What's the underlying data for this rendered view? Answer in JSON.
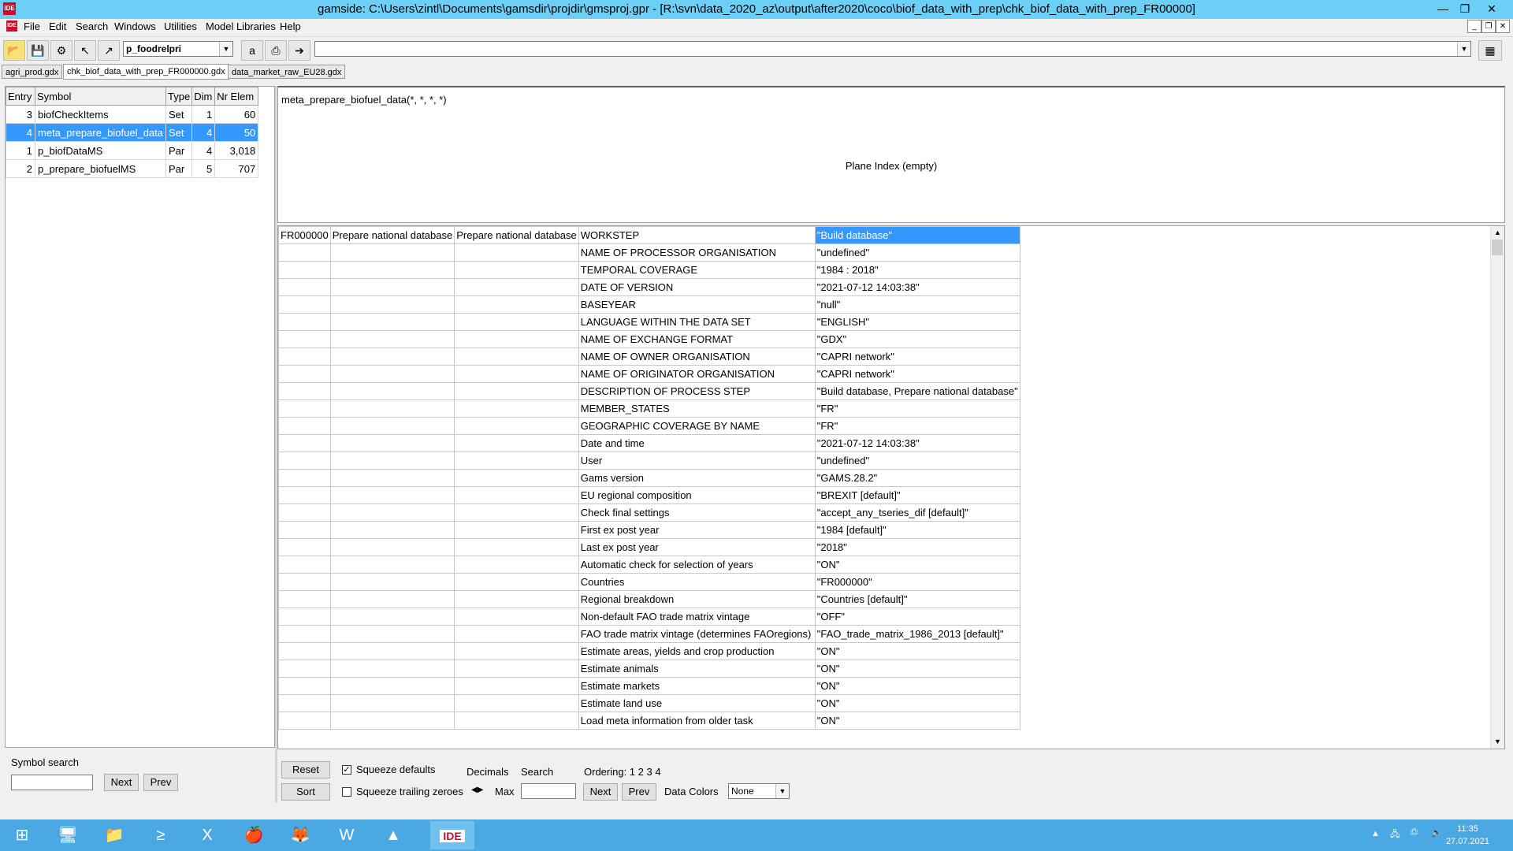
{
  "window": {
    "title": "gamside: C:\\Users\\zintl\\Documents\\gamsdir\\projdir\\gmsproj.gpr - [R:\\svn\\data_2020_az\\output\\after2020\\coco\\biof_data_with_prep\\chk_biof_data_with_prep_FR00000]",
    "app_icon_text": "IDE"
  },
  "menu": [
    "File",
    "Edit",
    "Search",
    "Windows",
    "Utilities",
    "Model Libraries",
    "Help"
  ],
  "toolbar": {
    "symbol_combo_value": "p_foodrelpri",
    "a_label": "a",
    "command_combo_value": ""
  },
  "tabs": [
    "agri_prod.gdx",
    "chk_biof_data_with_prep_FR000000.gdx",
    "data_market_raw_EU28.gdx"
  ],
  "symbols": {
    "headers": [
      "Entry",
      "Symbol",
      "Type",
      "Dim",
      "Nr Elem"
    ],
    "rows": [
      {
        "entry": "3",
        "symbol": "biofCheckItems",
        "type": "Set",
        "dim": "1",
        "nr": "60"
      },
      {
        "entry": "4",
        "symbol": "meta_prepare_biofuel_data",
        "type": "Set",
        "dim": "4",
        "nr": "50"
      },
      {
        "entry": "1",
        "symbol": "p_biofDataMS",
        "type": "Par",
        "dim": "4",
        "nr": "3,018"
      },
      {
        "entry": "2",
        "symbol": "p_prepare_biofuelMS",
        "type": "Par",
        "dim": "5",
        "nr": "707"
      }
    ]
  },
  "symbol_search": {
    "label": "Symbol search",
    "value": "",
    "next": "Next",
    "prev": "Prev"
  },
  "plane": {
    "domain": "meta_prepare_biofuel_data(*, *, *, *)",
    "empty": "Plane Index (empty)"
  },
  "grid": {
    "first_row": {
      "c1": "FR000000",
      "c2": "Prepare national database",
      "c3": "Prepare national database",
      "key": "WORKSTEP",
      "value": "\"Build database\""
    },
    "rows": [
      {
        "key": "NAME OF PROCESSOR ORGANISATION",
        "value": "\"undefined\""
      },
      {
        "key": "TEMPORAL COVERAGE",
        "value": "\"1984 : 2018\""
      },
      {
        "key": "DATE OF VERSION",
        "value": "\"2021-07-12 14:03:38\""
      },
      {
        "key": "BASEYEAR",
        "value": "\"null\""
      },
      {
        "key": "LANGUAGE WITHIN THE DATA SET",
        "value": "\"ENGLISH\""
      },
      {
        "key": "NAME OF EXCHANGE FORMAT",
        "value": "\"GDX\""
      },
      {
        "key": "NAME OF OWNER ORGANISATION",
        "value": "\"CAPRI network\""
      },
      {
        "key": "NAME OF ORIGINATOR ORGANISATION",
        "value": "\"CAPRI network\""
      },
      {
        "key": "DESCRIPTION OF PROCESS STEP",
        "value": "\"Build database, Prepare national database\""
      },
      {
        "key": "MEMBER_STATES",
        "value": "\"FR\""
      },
      {
        "key": "GEOGRAPHIC COVERAGE BY NAME",
        "value": "\"FR\""
      },
      {
        "key": "Date and time",
        "value": "\"2021-07-12 14:03:38\""
      },
      {
        "key": "User",
        "value": "\"undefined\""
      },
      {
        "key": "Gams version",
        "value": "\"GAMS.28.2\""
      },
      {
        "key": "EU regional composition",
        "value": "\"BREXIT [default]\""
      },
      {
        "key": "Check final settings",
        "value": "\"accept_any_tseries_dif [default]\""
      },
      {
        "key": "First ex post year",
        "value": "\"1984 [default]\""
      },
      {
        "key": "Last ex post year",
        "value": "\"2018\""
      },
      {
        "key": "Automatic check for selection of years",
        "value": "\"ON\""
      },
      {
        "key": "Countries",
        "value": "\"FR000000\""
      },
      {
        "key": "Regional breakdown",
        "value": "\"Countries [default]\""
      },
      {
        "key": "Non-default FAO trade matrix vintage",
        "value": "\"OFF\""
      },
      {
        "key": "FAO trade matrix vintage (determines FAOregions)",
        "value": "\"FAO_trade_matrix_1986_2013 [default]\""
      },
      {
        "key": "Estimate areas, yields and crop production",
        "value": "\"ON\""
      },
      {
        "key": "Estimate animals",
        "value": "\"ON\""
      },
      {
        "key": "Estimate markets",
        "value": "\"ON\""
      },
      {
        "key": "Estimate land use",
        "value": "\"ON\""
      },
      {
        "key": "Load meta information from older task",
        "value": "\"ON\""
      }
    ]
  },
  "controls": {
    "reset": "Reset",
    "sort": "Sort",
    "squeeze_defaults": "Squeeze defaults",
    "squeeze_trailing": "Squeeze trailing zeroes",
    "decimals": "Decimals",
    "max": "Max",
    "search": "Search",
    "search_value": "",
    "next": "Next",
    "prev": "Prev",
    "ordering": "Ordering: 1 2 3 4",
    "data_colors": "Data Colors",
    "data_colors_value": "None",
    "check_mark": "✓"
  },
  "taskbar": {
    "clock_time": "11:35",
    "clock_date": "27.07.2021",
    "ide_label": "IDE"
  }
}
